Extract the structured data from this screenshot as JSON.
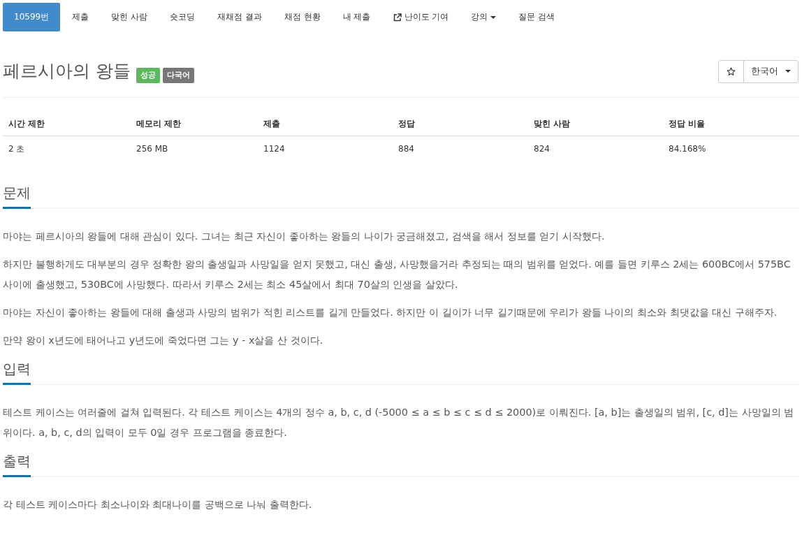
{
  "nav": {
    "tabs": [
      {
        "label": "10599번",
        "kind": "link",
        "selected": true
      },
      {
        "label": "제출",
        "kind": "link",
        "selected": false
      },
      {
        "label": "맞힌 사람",
        "kind": "link",
        "selected": false
      },
      {
        "label": "숏코딩",
        "kind": "link",
        "selected": false
      },
      {
        "label": "재채점 결과",
        "kind": "link",
        "selected": false
      },
      {
        "label": "채점 현황",
        "kind": "link",
        "selected": false
      },
      {
        "label": "내 제출",
        "kind": "link",
        "selected": false
      },
      {
        "label": "난이도 기여",
        "kind": "external",
        "selected": false
      },
      {
        "label": "강의",
        "kind": "dropdown",
        "selected": false
      },
      {
        "label": "질문 검색",
        "kind": "link",
        "selected": false
      }
    ]
  },
  "problem": {
    "title": "페르시아의 왕들",
    "labels": [
      {
        "text": "성공",
        "color": "#5cb85c"
      },
      {
        "text": "다국어",
        "color": "#777777"
      }
    ],
    "language": "한국어"
  },
  "stats": {
    "columns": [
      "시간 제한",
      "메모리 제한",
      "제출",
      "정답",
      "맞힌 사람",
      "정답 비율"
    ],
    "rows": [
      [
        "2 초",
        "256 MB",
        "1124",
        "884",
        "824",
        "84.168%"
      ]
    ]
  },
  "sections": [
    {
      "heading": "문제",
      "paragraphs": [
        "마야는 페르시아의 왕들에 대해 관심이 있다. 그녀는 최근 자신이 좋아하는 왕들의 나이가 궁금해졌고, 검색을 해서 정보를 얻기 시작했다.",
        "하지만 불행하게도 대부분의 경우 정확한 왕의 출생일과 사망일을 얻지 못했고, 대신 출생, 사망했을거라 추정되는 때의 범위를 얻었다. 예를 들면 키루스 2세는 600BC에서 575BC사이에 출생했고, 530BC에 사망했다. 따라서 키루스 2세는 최소 45살에서 최대 70살의 인생을 살았다.",
        "마야는 자신이 좋아하는 왕들에 대해 출생과 사망의 범위가 적힌 리스트를 길게 만들었다. 하지만 이 길이가 너무 길기때문에 우리가 왕들 나이의 최소와 최댓값을 대신 구해주자.",
        "만약 왕이 x년도에 태어나고 y년도에 죽었다면 그는 y - x살을 산 것이다."
      ]
    },
    {
      "heading": "입력",
      "paragraphs": [
        "테스트 케이스는 여러줄에 걸쳐 입력된다. 각 테스트 케이스는 4개의 정수 a, b, c, d (-5000 ≤ a ≤ b ≤ c ≤ d ≤ 2000)로 이뤄진다. [a, b]는 출생일의 범위, [c, d]는 사망일의 범위이다. a, b, c, d의 입력이 모두 0일 경우 프로그램을 종료한다."
      ]
    },
    {
      "heading": "출력",
      "paragraphs": [
        "각 테스트 케이스마다 최소나이와 최대나이를 공백으로 나눠 출력한다."
      ]
    }
  ]
}
